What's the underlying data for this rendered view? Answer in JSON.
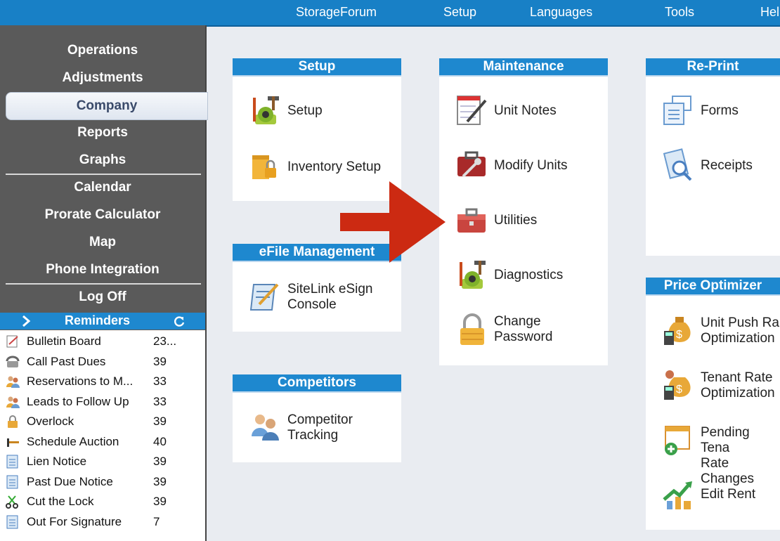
{
  "menu": {
    "items": [
      "StorageForum",
      "Setup",
      "Languages",
      "Tools",
      "Hel"
    ]
  },
  "sidebar": {
    "items": [
      {
        "label": "Operations"
      },
      {
        "label": "Adjustments"
      },
      {
        "label": "Company"
      },
      {
        "label": "Reports"
      },
      {
        "label": "Graphs"
      },
      {
        "label": "Calendar"
      },
      {
        "label": "Prorate Calculator"
      },
      {
        "label": "Map"
      },
      {
        "label": "Phone Integration"
      },
      {
        "label": "Log Off"
      }
    ],
    "active_item": "Company"
  },
  "reminders": {
    "title": "Reminders",
    "items": [
      {
        "label": "Bulletin Board",
        "count": "23...",
        "icon": "notepad-icon"
      },
      {
        "label": "Call Past Dues",
        "count": "39",
        "icon": "telephone-icon"
      },
      {
        "label": "Reservations to M...",
        "count": "33",
        "icon": "people-icon"
      },
      {
        "label": "Leads to Follow Up",
        "count": "33",
        "icon": "people-icon"
      },
      {
        "label": "Overlock",
        "count": "39",
        "icon": "padlock-icon"
      },
      {
        "label": "Schedule Auction",
        "count": "40",
        "icon": "gavel-icon"
      },
      {
        "label": "Lien Notice",
        "count": "39",
        "icon": "document-icon"
      },
      {
        "label": "Past Due Notice",
        "count": "39",
        "icon": "document-icon"
      },
      {
        "label": "Cut the Lock",
        "count": "39",
        "icon": "scissors-icon"
      },
      {
        "label": "Out For Signature",
        "count": "7",
        "icon": "document-icon"
      }
    ]
  },
  "panels": {
    "setup": {
      "title": "Setup",
      "tiles": [
        {
          "label": "Setup"
        },
        {
          "label": "Inventory Setup"
        }
      ]
    },
    "efile": {
      "title": "eFile Management",
      "tiles": [
        {
          "label": "SiteLink eSign\nConsole"
        }
      ]
    },
    "competitors": {
      "title": "Competitors",
      "tiles": [
        {
          "label": "Competitor\nTracking"
        }
      ]
    },
    "maintenance": {
      "title": "Maintenance",
      "tiles": [
        {
          "label": "Unit Notes"
        },
        {
          "label": "Modify Units"
        },
        {
          "label": "Utilities"
        },
        {
          "label": "Diagnostics"
        },
        {
          "label": "Change\nPassword"
        }
      ]
    },
    "reprint": {
      "title": "Re-Print",
      "tiles": [
        {
          "label": "Forms"
        },
        {
          "label": "Receipts"
        }
      ]
    },
    "price": {
      "title": "Price Optimizer",
      "tiles": [
        {
          "label": "Unit Push Ra\nOptimization"
        },
        {
          "label": "Tenant Rate\nOptimization"
        },
        {
          "label": "Pending Tena\nRate Changes"
        },
        {
          "label": "Edit Rent"
        }
      ]
    }
  },
  "colors": {
    "accent": "#1e88cf",
    "sidebar": "#5a5a5a",
    "arrow": "#cc2a12",
    "background": "#e9ecf1"
  }
}
